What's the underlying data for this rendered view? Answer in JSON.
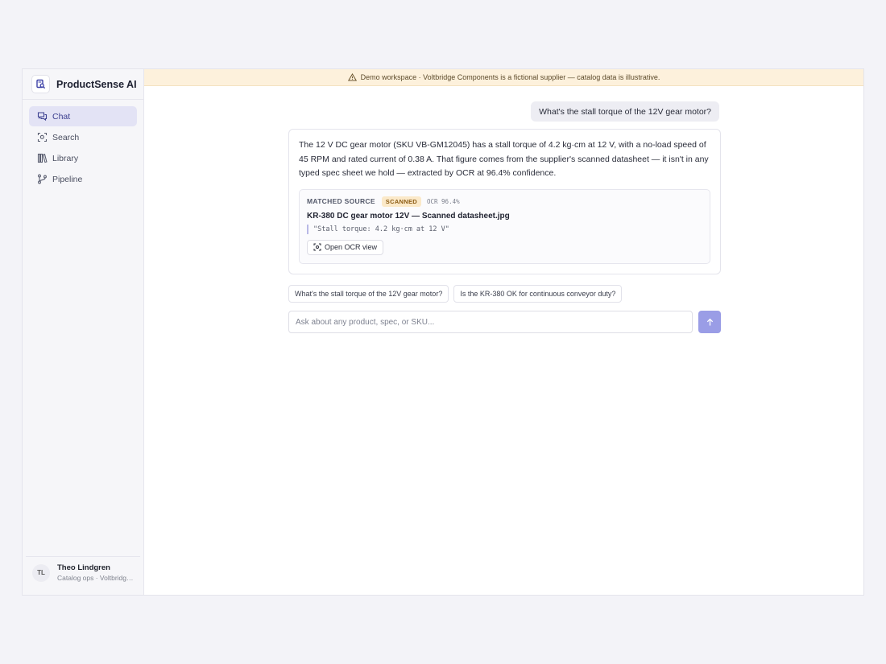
{
  "app": {
    "name": "ProductSense AI"
  },
  "sidebar": {
    "items": [
      {
        "label": "Chat",
        "icon": "chat-icon",
        "active": true
      },
      {
        "label": "Search",
        "icon": "scan-search-icon",
        "active": false
      },
      {
        "label": "Library",
        "icon": "library-icon",
        "active": false
      },
      {
        "label": "Pipeline",
        "icon": "pipeline-icon",
        "active": false
      }
    ]
  },
  "user": {
    "initials": "TL",
    "name": "Theo Lindgren",
    "role": "Catalog ops · Voltbridge Components"
  },
  "banner": {
    "icon": "warning-icon",
    "text": "Demo workspace · Voltbridge Components is a fictional supplier — catalog data is illustrative."
  },
  "conversation": {
    "user_message": "What's the stall torque of the 12V gear motor?",
    "answer": "The 12 V DC gear motor (SKU VB-GM12045) has a stall torque of 4.2 kg·cm at 12 V, with a no-load speed of 45 RPM and rated current of 0.38 A. That figure comes from the supplier's scanned datasheet — it isn't in any typed spec sheet we hold — extracted by OCR at 96.4% confidence.",
    "source": {
      "label": "MATCHED SOURCE",
      "badge": "SCANNED",
      "ocr": "OCR 96.4%",
      "title": "KR-380 DC gear motor 12V — Scanned datasheet.jpg",
      "quote": "\"Stall torque: 4.2 kg·cm at 12 V\"",
      "button": "Open OCR view"
    }
  },
  "suggestions": [
    "What's the stall torque of the 12V gear motor?",
    "Is the KR-380 OK for continuous conveyor duty?"
  ],
  "composer": {
    "placeholder": "Ask about any product, spec, or SKU...",
    "value": ""
  },
  "colors": {
    "accent": "#9a9de6",
    "active_nav_bg": "#e3e3f5",
    "banner_bg": "#fdf1dc",
    "scanned_badge_bg": "#fbe9c9"
  }
}
